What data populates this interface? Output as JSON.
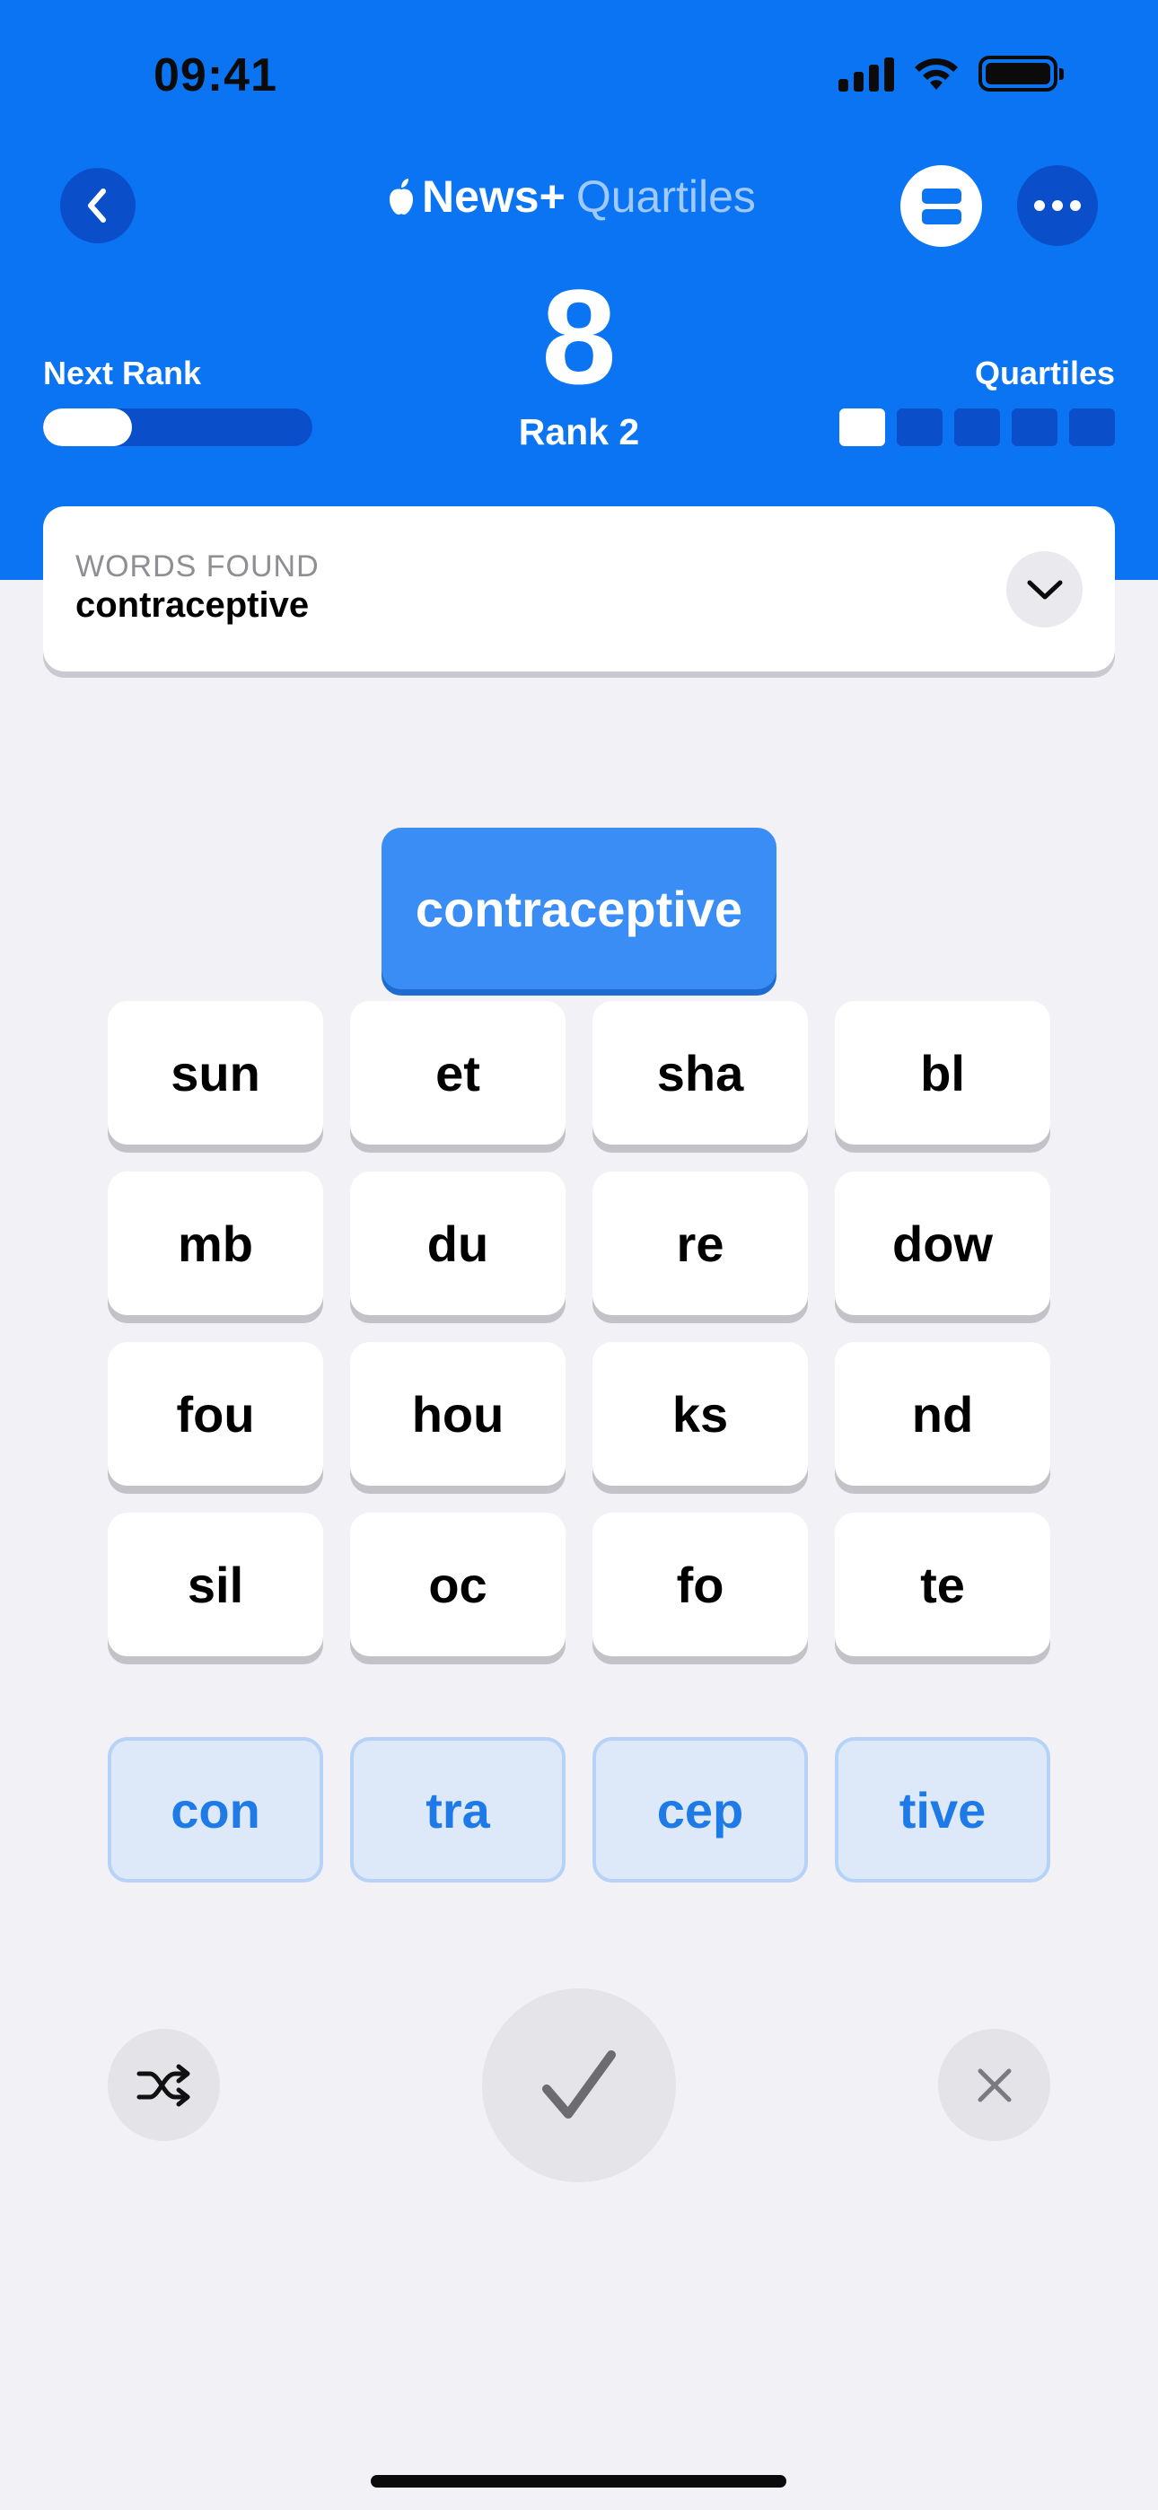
{
  "status_bar": {
    "time": "09:41"
  },
  "header": {
    "brand_name": "News+",
    "game_name": "Quartiles",
    "score": "8",
    "rank": "Rank 2",
    "next_rank_label": "Next Rank",
    "next_rank_progress": 0.33,
    "quartiles_label": "Quartiles",
    "quartiles_found": 1,
    "quartiles_total": 5
  },
  "words_found": {
    "title": "WORDS FOUND",
    "list": "contraceptive"
  },
  "current_word": "contraceptive",
  "tiles": [
    "sun",
    "et",
    "sha",
    "bl",
    "mb",
    "du",
    "re",
    "dow",
    "fou",
    "hou",
    "ks",
    "nd",
    "sil",
    "oc",
    "fo",
    "te"
  ],
  "selected_tiles": [
    "con",
    "tra",
    "cep",
    "tive"
  ],
  "colors": {
    "header_blue": "#0A74F2",
    "dark_blue": "#0A4FC9",
    "word_blue": "#3A8DF5",
    "selected_text": "#1E7AE6",
    "background": "#F1F1F6"
  },
  "icons": {
    "back": "chevron-left-icon",
    "layout": "layout-rows-icon",
    "more": "ellipsis-icon",
    "expand": "chevron-down-icon",
    "shuffle": "shuffle-icon",
    "submit": "checkmark-icon",
    "clear": "close-icon"
  }
}
